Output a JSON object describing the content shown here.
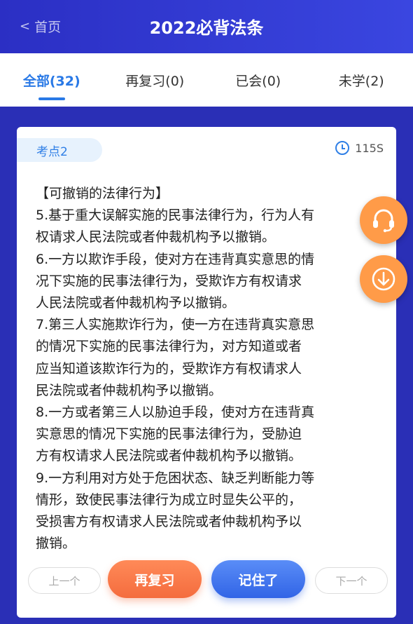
{
  "header": {
    "back_label": "首页",
    "back_chevron": "<",
    "title": "2022必背法条"
  },
  "tabs": [
    {
      "label": "全部(32)",
      "active": true
    },
    {
      "label": "再复习(0)",
      "active": false
    },
    {
      "label": "已会(0)",
      "active": false
    },
    {
      "label": "未学(2)",
      "active": false
    }
  ],
  "card": {
    "tag": "考点2",
    "timer": "115S",
    "lines": [
      "【可撤销的法律行为】",
      "5.基于重大误解实施的民事法律行为，行为人有",
      "权请求人民法院或者仲裁机构予以撤销。",
      "6.一方以欺诈手段，使对方在违背真实意思的情",
      "况下实施的民事法律行为，受欺诈方有权请求",
      "人民法院或者仲裁机构予以撤销。",
      "7.第三人实施欺诈行为，使一方在违背真实意思",
      "的情况下实施的民事法律行为，对方知道或者",
      "应当知道该欺诈行为的，受欺诈方有权请求人",
      "民法院或者仲裁机构予以撤销。",
      "8.一方或者第三人以胁迫手段，使对方在违背真",
      "实意思的情况下实施的民事法律行为，受胁迫",
      "方有权请求人民法院或者仲裁机构予以撤销。",
      "9.一方利用对方处于危困状态、缺乏判断能力等",
      "情形，致使民事法律行为成立时显失公平的，",
      "受损害方有权请求人民法院或者仲裁机构予以",
      "撤销。"
    ]
  },
  "buttons": {
    "prev": "上一个",
    "review": "再复习",
    "remember": "记住了",
    "next": "下一个"
  },
  "floating": {
    "headset_icon": "headset-icon",
    "download_icon": "download-icon"
  },
  "colors": {
    "primary": "#2979e6",
    "header_bg": "#2b2fc4",
    "accent_orange": "#f46c3e",
    "accent_blue": "#3164e6",
    "fab_orange": "#ff9b48"
  }
}
